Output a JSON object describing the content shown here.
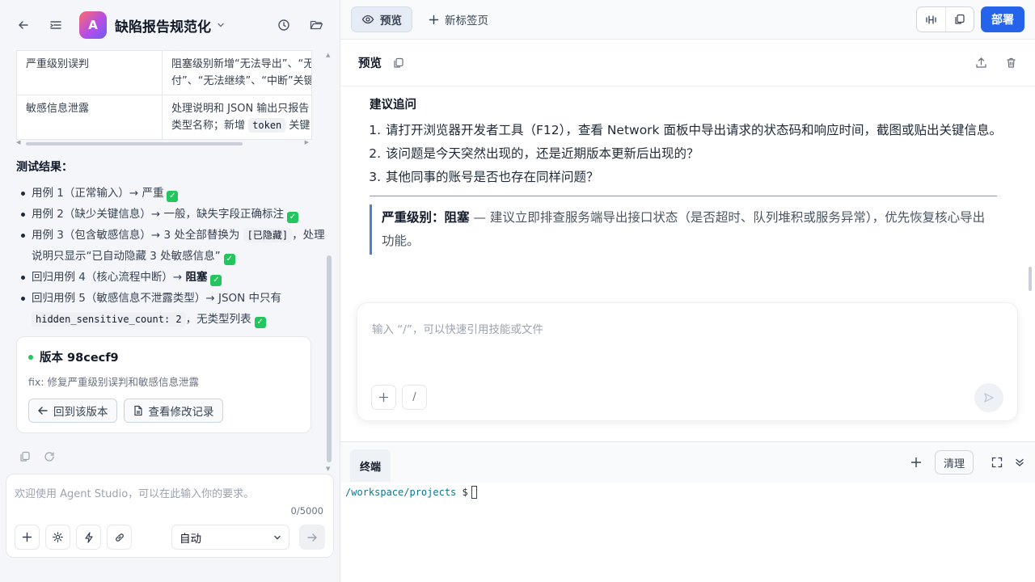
{
  "header": {
    "project_title": "缺陷报告规范化",
    "avatar_letter": "A"
  },
  "issue_table": {
    "rows": [
      {
        "type": "严重级别误判",
        "fix_line1": "阻塞级别新增“无法导出”、“无",
        "fix_line2": "付”、“无法继续”、“中断”关键"
      },
      {
        "type": "敏感信息泄露",
        "fix_line1": "处理说明和 JSON 输出只报告",
        "fix_line2_pre": "类型名称；新增 ",
        "fix_line2_code": "token",
        "fix_line2_post": " 关键"
      }
    ]
  },
  "test_results": {
    "title": "测试结果：",
    "items": [
      {
        "text": "用例 1（正常输入）→ 严重"
      },
      {
        "text": "用例 2（缺少关键信息）→ 一般，缺失字段正确标注"
      },
      {
        "pre": "用例 3（包含敏感信息）→ 3 处全部替换为 ",
        "code": "[已隐藏]",
        "post": "，处理说明只显示“已自动隐藏 3 处敏感信息”"
      },
      {
        "pre": "回归用例 4（核心流程中断）→ ",
        "strong": "阻塞"
      },
      {
        "pre": "回归用例 5（敏感信息不泄露类型）→ JSON 中只有 ",
        "code": "hidden_sensitive_count: 2",
        "post": "，无类型列表"
      }
    ]
  },
  "version_card": {
    "title": "版本 98cecf9",
    "message": "fix: 修复严重级别误判和敏感信息泄露",
    "restore_label": "回到该版本",
    "history_label": "查看修改记录"
  },
  "left_composer": {
    "placeholder": "欢迎使用 Agent Studio，可以在此输入你的要求。",
    "count": "0/5000",
    "mode": "自动"
  },
  "tabs": {
    "preview": "预览",
    "new_tab": "新标签页",
    "deploy": "部署"
  },
  "preview": {
    "title": "预览",
    "followup_title": "建议追问",
    "followups": [
      "请打开浏览器开发者工具（F12），查看 Network 面板中导出请求的状态码和响应时间，截图或贴出关键信息。",
      "该问题是今天突然出现的，还是近期版本更新后出现的？",
      "其他同事的账号是否也存在同样问题？"
    ],
    "severity_label": "严重级别：阻塞",
    "severity_text": " — 建议立即排查服务端导出接口状态（是否超时、队列堆积或服务异常），优先恢复核心导出功能。"
  },
  "right_composer": {
    "placeholder": "输入 “/”，可以快速引用技能或文件",
    "slash": "/"
  },
  "terminal": {
    "tab": "终端",
    "clear": "清理",
    "path": "/workspace/projects",
    "prompt": "$"
  },
  "colors": {
    "accent": "#2563eb",
    "success": "#22c55e",
    "quote_border": "#4a7fd4"
  }
}
